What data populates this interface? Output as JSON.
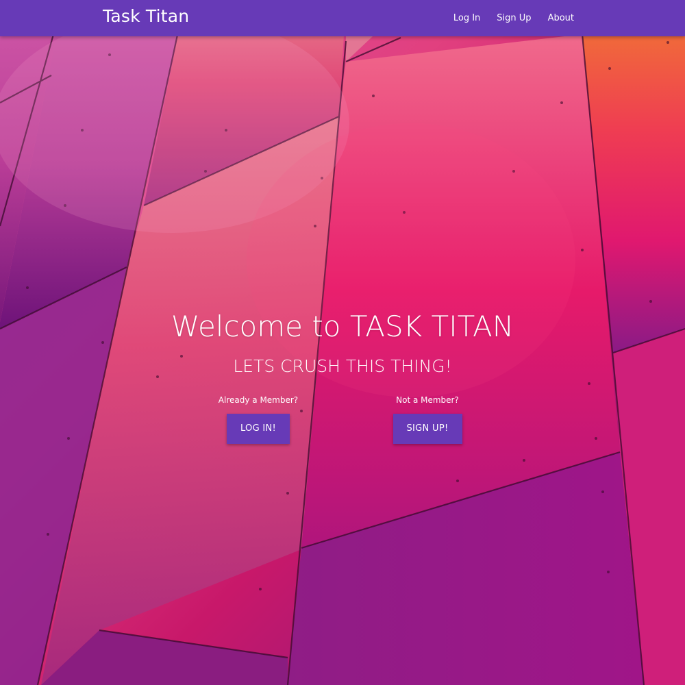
{
  "navbar": {
    "brand": "Task Titan",
    "links": [
      {
        "label": "Log In"
      },
      {
        "label": "Sign Up"
      },
      {
        "label": "About"
      }
    ],
    "color": "#673ab7"
  },
  "hero": {
    "title": "Welcome to TASK TITAN",
    "tagline": "LETS CRUSH THIS THING!",
    "login": {
      "prompt": "Already a Member?",
      "button": "LOG IN!"
    },
    "signup": {
      "prompt": "Not a Member?",
      "button": "SIGN UP!"
    }
  },
  "colors": {
    "accent": "#673ab7",
    "background_pink": "#e0186f",
    "background_purple": "#7a1a86",
    "background_orange": "#f06a3a"
  }
}
